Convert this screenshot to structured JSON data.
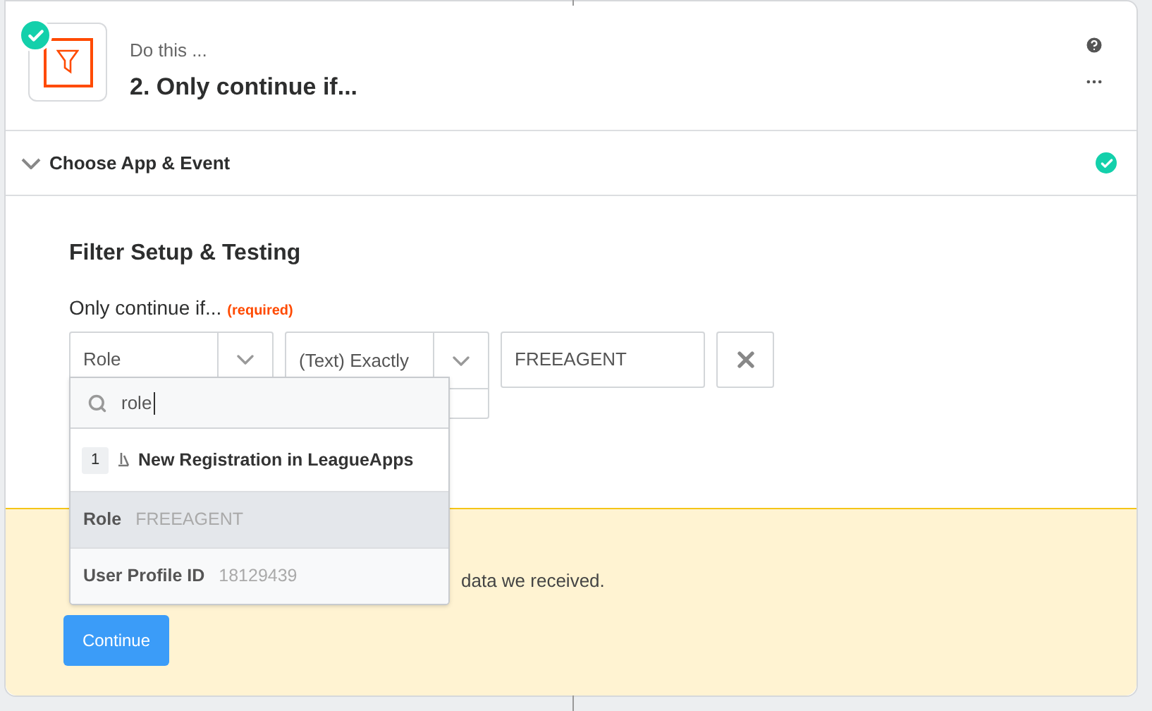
{
  "step": {
    "completed": true,
    "subtitle": "Do this ...",
    "title": "2. Only continue if..."
  },
  "section": {
    "title": "Choose App & Event",
    "expanded": true,
    "completed": true
  },
  "filter": {
    "heading": "Filter Setup & Testing",
    "label": "Only continue if...",
    "required": "(required)",
    "field": {
      "value": "Role"
    },
    "condition": {
      "value": "(Text) Exactly"
    },
    "value": {
      "value": "FREEAGENT"
    }
  },
  "dropdown": {
    "search": {
      "value": "role"
    },
    "group": {
      "number": "1",
      "title": "New Registration in LeagueApps"
    },
    "options": [
      {
        "name": "Role",
        "sample": "FREEAGENT",
        "selected": true
      },
      {
        "name": "User Profile ID",
        "sample": "18129439",
        "selected": false
      }
    ]
  },
  "notice": {
    "line_2_end": "data we received.",
    "button": "Continue"
  }
}
